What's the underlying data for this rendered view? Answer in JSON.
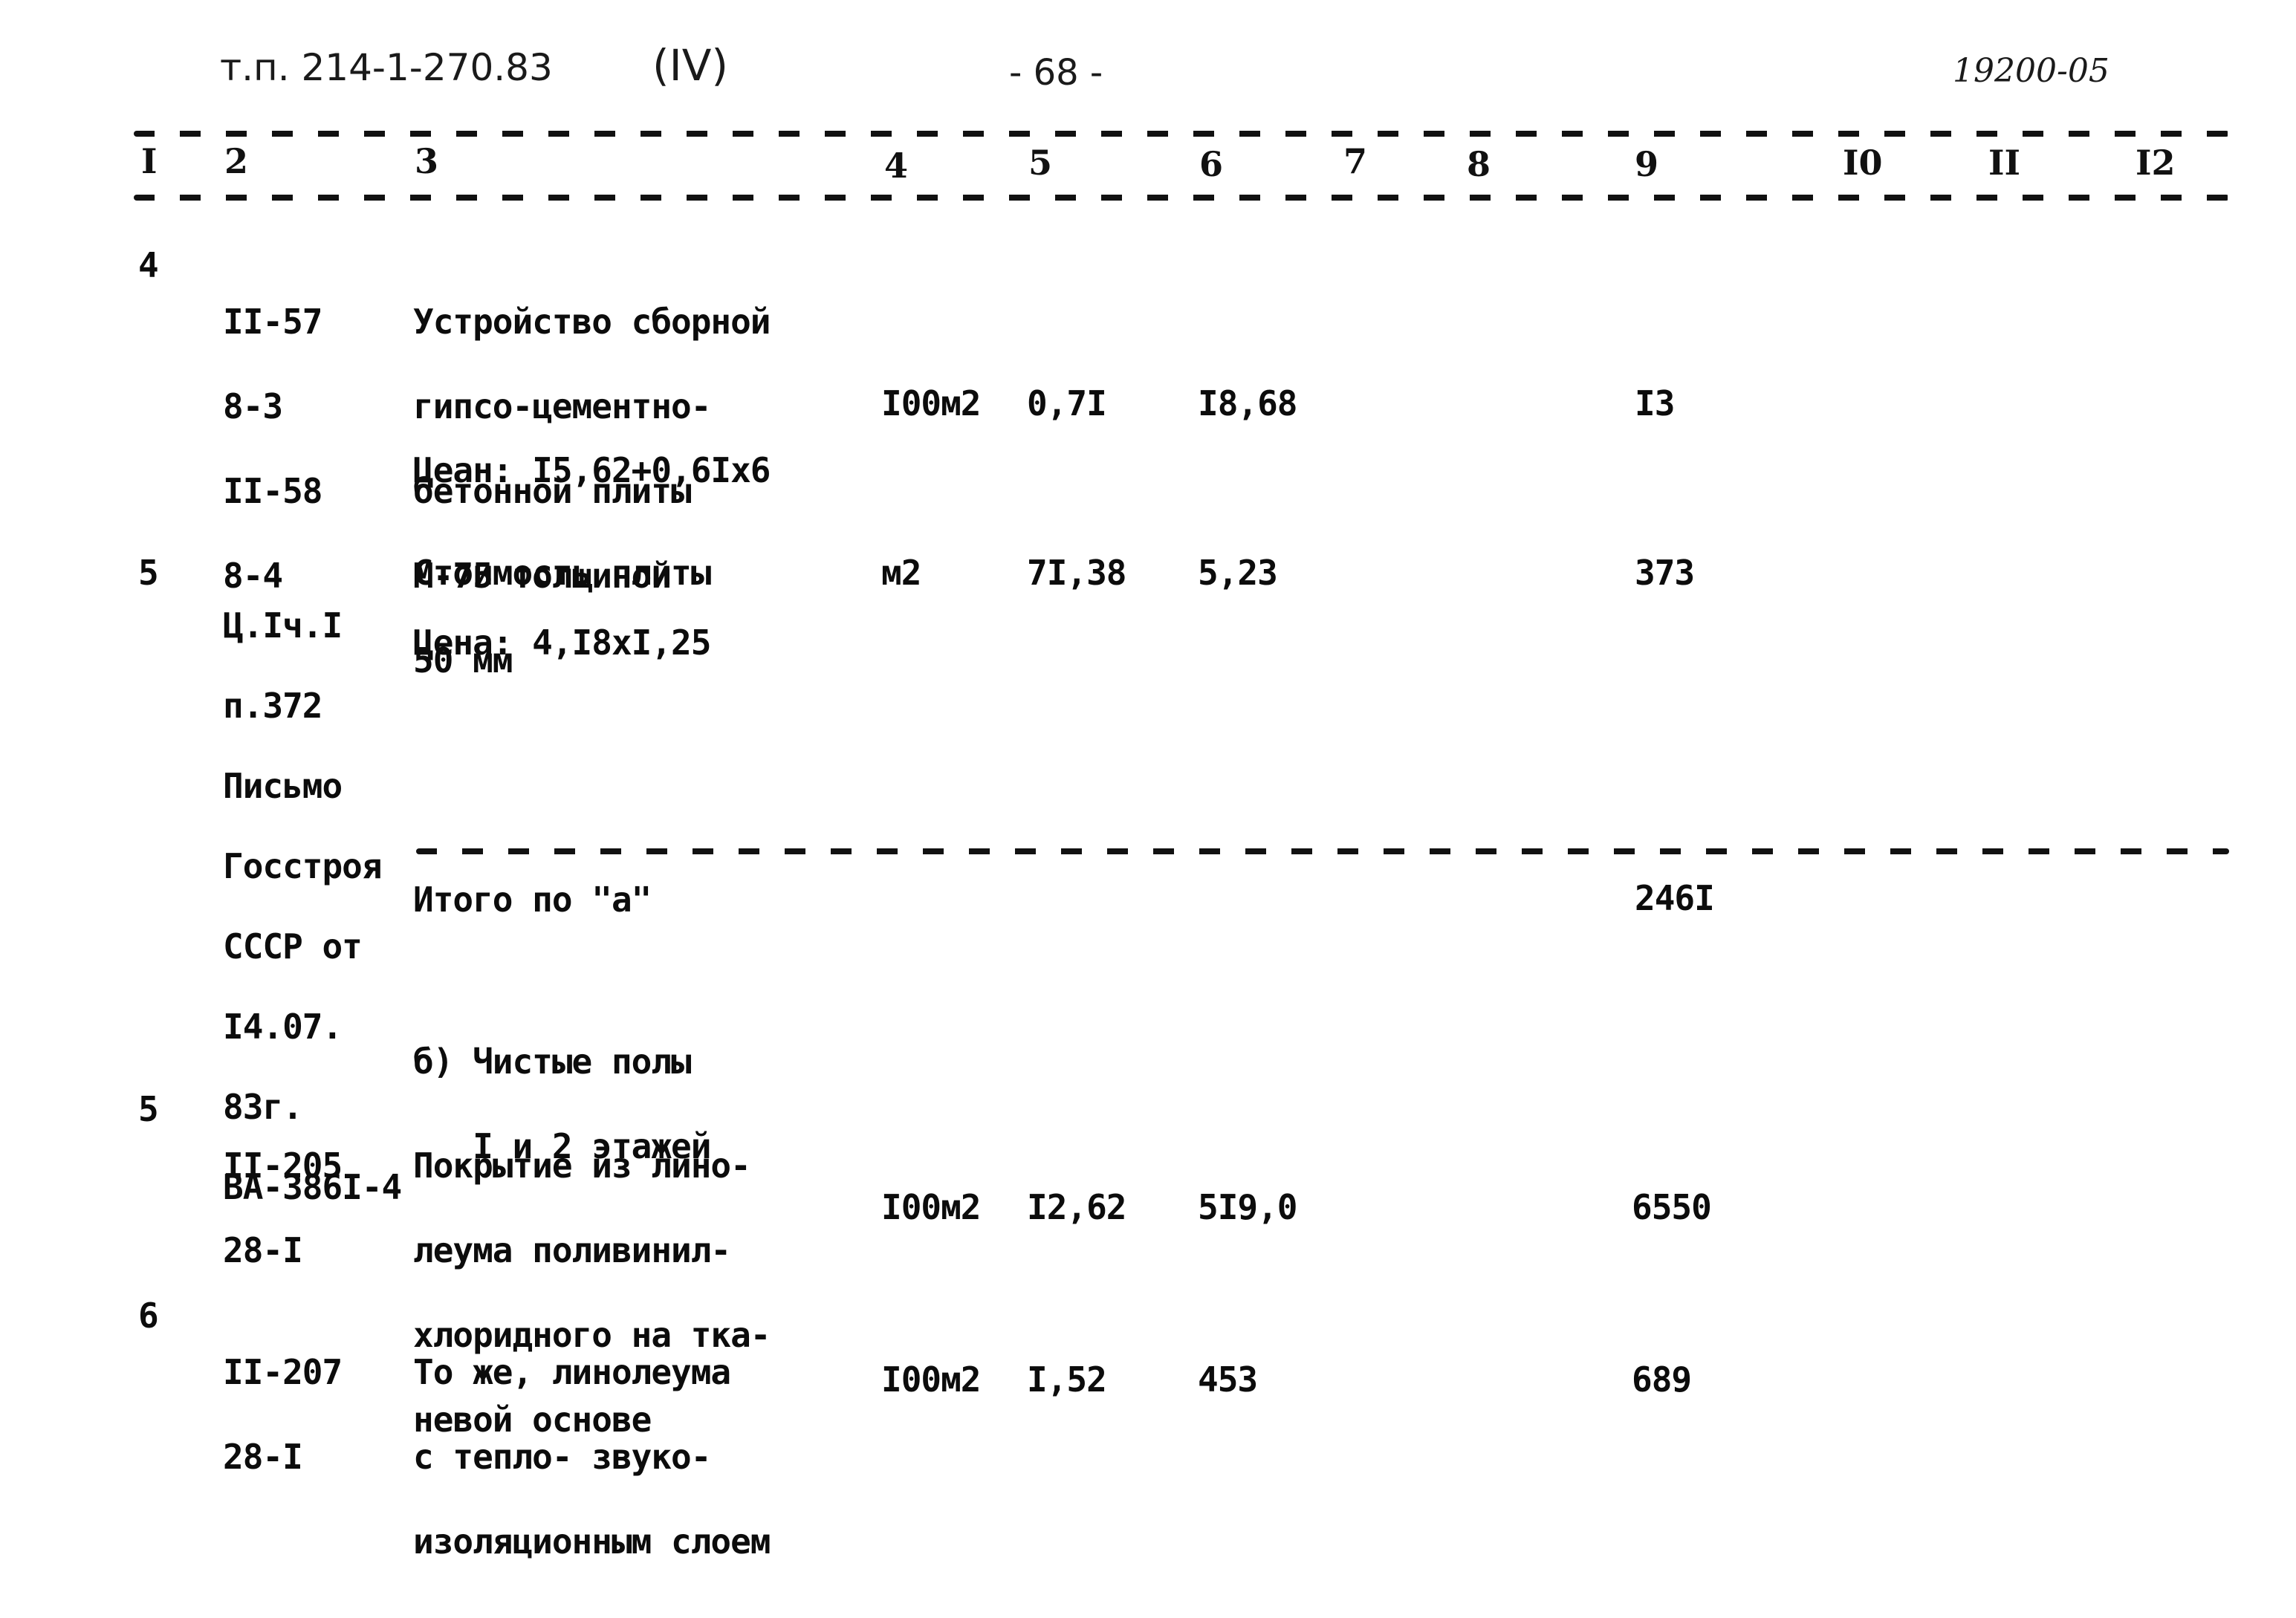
{
  "header": {
    "doc_ref": "т.п. 214-1-270.83",
    "volume": "(IV)",
    "page_number": "- 68 -",
    "archive_number": "19200-05"
  },
  "columns": [
    "I",
    "2",
    "3",
    "4",
    "5",
    "6",
    "7",
    "8",
    "9",
    "I0",
    "II",
    "I2"
  ],
  "rows": [
    {
      "num": "4",
      "codes": [
        "II-57",
        "8-3",
        "II-58",
        "8-4"
      ],
      "description": [
        "Устройство сборной",
        "гипсо-цементно-",
        "бетонной плиты",
        "М-75 толщиной",
        "50 мм"
      ],
      "note": "Цеан: I5,62+0,6Ix6",
      "unit": "I00м2",
      "quantity": "0,7I",
      "unit_price": "I8,68",
      "total": "I3"
    },
    {
      "num": "5",
      "codes": [
        "Ц.Iч.I",
        "п.372",
        "Письмо",
        "Госстроя",
        "СССР от",
        "I4.07.",
        "83г.",
        "ВА-386I-4"
      ],
      "description": [
        "Стоимость плиты"
      ],
      "note": "Цена: 4,I8xI,25",
      "unit": "м2",
      "quantity": "7I,38",
      "unit_price": "5,23",
      "total": "373"
    }
  ],
  "subtotal": {
    "label": "Итого по \"а\"",
    "total": "246I"
  },
  "section_b": {
    "title": [
      "б) Чистые полы",
      "   I и 2 этажей"
    ]
  },
  "rows_b": [
    {
      "num": "5",
      "codes": [
        "II-205",
        "28-I"
      ],
      "description": [
        "Покрытие из лино-",
        "леума поливинил-",
        "хлоридного на тка-",
        "невой основе"
      ],
      "unit": "I00м2",
      "quantity": "I2,62",
      "unit_price": "5I9,0",
      "total": "6550"
    },
    {
      "num": "6",
      "codes": [
        "II-207",
        "28-I"
      ],
      "description": [
        "То же, линолеума",
        "с тепло- звуко-",
        "изоляционным слоем"
      ],
      "unit": "I00м2",
      "quantity": "I,52",
      "unit_price": "453",
      "total": "689"
    }
  ]
}
